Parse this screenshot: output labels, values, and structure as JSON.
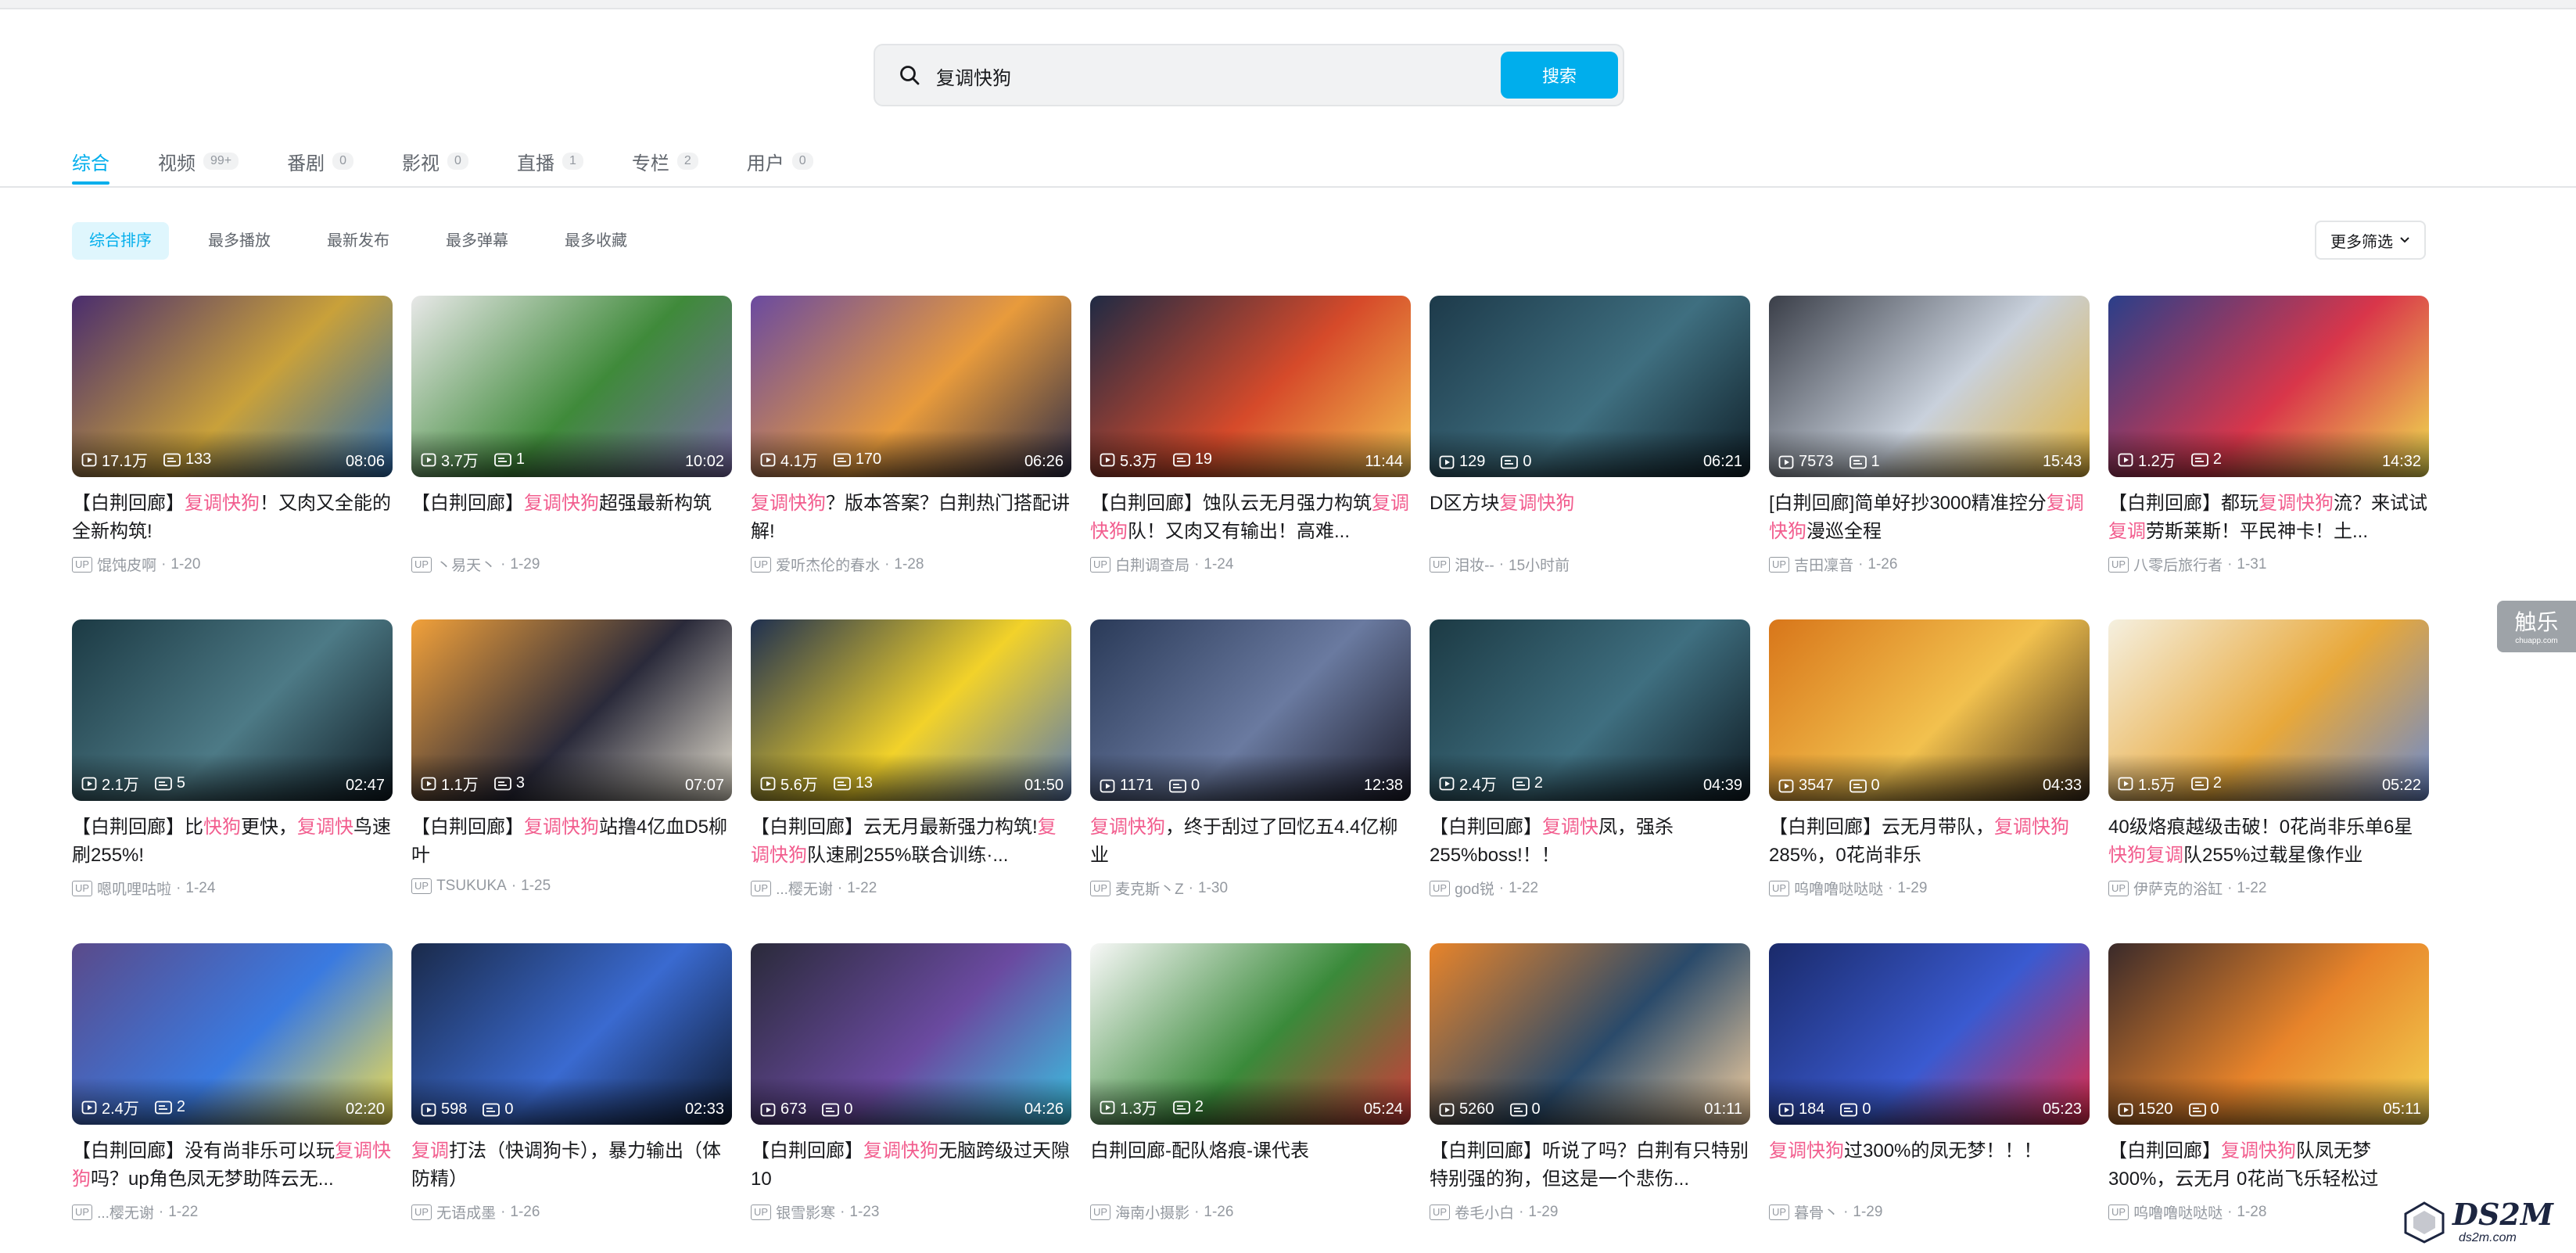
{
  "search": {
    "query": "复调快狗",
    "button_label": "搜索"
  },
  "tabs": [
    {
      "label": "综合",
      "count": ""
    },
    {
      "label": "视频",
      "count": "99+"
    },
    {
      "label": "番剧",
      "count": "0"
    },
    {
      "label": "影视",
      "count": "0"
    },
    {
      "label": "直播",
      "count": "1"
    },
    {
      "label": "专栏",
      "count": "2"
    },
    {
      "label": "用户",
      "count": "0"
    }
  ],
  "sort": [
    "综合排序",
    "最多播放",
    "最新发布",
    "最多弹幕",
    "最多收藏"
  ],
  "more_filter_label": "更多筛选",
  "up_badge": "UP",
  "side_widget": {
    "big": "触乐",
    "small": "chuapp.com"
  },
  "watermark": {
    "text": "DS2M",
    "sub": "ds2m.com"
  },
  "videos": [
    {
      "plays": "17.1万",
      "danmaku": "133",
      "duration": "08:06",
      "title": "【白荆回廊】<h>复调快狗</h>！又肉又全能的全新构筑!",
      "author": "馄饨皮啊",
      "date": "1-20",
      "colors": [
        "#4a2d6e",
        "#c9a13a",
        "#2b6cb0"
      ]
    },
    {
      "plays": "3.7万",
      "danmaku": "1",
      "duration": "10:02",
      "title": "【白荆回廊】<h>复调快狗</h>超强最新构筑",
      "author": "丶易天丶",
      "date": "1-29",
      "colors": [
        "#e8e8e8",
        "#3f8a3a",
        "#7b6aa8"
      ]
    },
    {
      "plays": "4.1万",
      "danmaku": "170",
      "duration": "06:26",
      "title": "<h>复调快狗</h>？版本答案？白荆热门搭配讲解!",
      "author": "爱听杰伦的春水",
      "date": "1-28",
      "colors": [
        "#6a4aa0",
        "#e89b3c",
        "#2c2c48"
      ]
    },
    {
      "plays": "5.3万",
      "danmaku": "19",
      "duration": "11:44",
      "title": "【白荆回廊】蚀队云无月强力构筑<h>复调快狗</h>队！又肉又有输出！高难...",
      "author": "白荆调查局",
      "date": "1-24",
      "colors": [
        "#1f2a44",
        "#d64a2a",
        "#f2c14e"
      ]
    },
    {
      "plays": "129",
      "danmaku": "0",
      "duration": "06:21",
      "title": "D区方块<h>复调快狗</h>",
      "author": "泪妆-- ",
      "date": "15小时前",
      "colors": [
        "#1d3a4a",
        "#3f6f80",
        "#0f1f28"
      ]
    },
    {
      "plays": "7573",
      "danmaku": "1",
      "duration": "15:43",
      "title": "[白荆回廊]简单好抄3000精准控分<h>复调快狗</h>漫巡全程",
      "author": "吉田凜音",
      "date": "1-26",
      "colors": [
        "#3a3e48",
        "#c9d1dc",
        "#e2b23a"
      ]
    },
    {
      "plays": "1.2万",
      "danmaku": "2",
      "duration": "14:32",
      "title": "【白荆回廊】都玩<h>复调快狗</h>流？来试试<h>复调</h>劳斯莱斯！平民神卡！土...",
      "author": "八零后旅行者",
      "date": "1-31",
      "colors": [
        "#2a3f8a",
        "#d9364a",
        "#f0e050"
      ]
    },
    {
      "plays": "2.1万",
      "danmaku": "5",
      "duration": "02:47",
      "title": "【白荆回廊】比<h>快狗</h>更快，<h>复调快</h>鸟速刷255%!",
      "author": "嗯叽哩咕啦",
      "date": "1-24",
      "colors": [
        "#1c3a44",
        "#4d7a86",
        "#0e1a22"
      ]
    },
    {
      "plays": "1.1万",
      "danmaku": "3",
      "duration": "07:07",
      "title": "【白荆回廊】<h>复调快狗</h>站撸4亿血D5柳叶",
      "author": "TSUKUKA",
      "date": "1-25",
      "colors": [
        "#f2a13a",
        "#2a2a3a",
        "#e6e0d0"
      ]
    },
    {
      "plays": "5.6万",
      "danmaku": "13",
      "duration": "01:50",
      "title": "【白荆回廊】云无月最新强力构筑!<h>复调快狗</h>队速刷255%联合训练·...",
      "author": "...樱无谢",
      "date": "1-22",
      "colors": [
        "#1f3050",
        "#f2d22a",
        "#5a7ab0"
      ]
    },
    {
      "plays": "1171",
      "danmaku": "0",
      "duration": "12:38",
      "title": "<h>复调快狗</h>，终于刮过了回忆五4.4亿柳业",
      "author": "麦克斯丶Z",
      "date": "1-30",
      "colors": [
        "#2a3a58",
        "#6a7aa0",
        "#1a1a28"
      ]
    },
    {
      "plays": "2.4万",
      "danmaku": "2",
      "duration": "04:39",
      "title": "【白荆回廊】<h>复调快</h>凤，强杀255%boss!！！",
      "author": "god锐",
      "date": "1-22",
      "colors": [
        "#1c3a44",
        "#3f6f80",
        "#0e1a22"
      ]
    },
    {
      "plays": "3547",
      "danmaku": "0",
      "duration": "04:33",
      "title": "【白荆回廊】云无月带队，<h>复调快狗</h>285%，0花尚非乐",
      "author": "呜噜噜哒哒哒",
      "date": "1-29",
      "colors": [
        "#d8761a",
        "#f2c14e",
        "#3a2a1a"
      ]
    },
    {
      "plays": "1.5万",
      "danmaku": "2",
      "duration": "05:22",
      "title": "40级烙痕越级击破！0花尚非乐单6星<h>快狗复调</h>队255%过载星像作业",
      "author": "伊萨克的浴缸",
      "date": "1-22",
      "colors": [
        "#f5f0e0",
        "#e8a83a",
        "#6a8ad0"
      ]
    },
    {
      "plays": "2.4万",
      "danmaku": "2",
      "duration": "02:20",
      "title": "【白荆回廊】没有尚非乐可以玩<h>复调快狗</h>吗？up角色凤无梦助阵云无...",
      "author": "...樱无谢",
      "date": "1-22",
      "colors": [
        "#5a4a8a",
        "#3a7ae0",
        "#f2e050"
      ]
    },
    {
      "plays": "598",
      "danmaku": "0",
      "duration": "02:33",
      "title": "<h>复调</h>打法（快调狗卡），暴力输出（体防精）",
      "author": "无语成墨",
      "date": "1-26",
      "colors": [
        "#1a2a4a",
        "#3a6ad0",
        "#0e1a30"
      ]
    },
    {
      "plays": "673",
      "danmaku": "0",
      "duration": "04:26",
      "title": "【白荆回廊】<h>复调快狗</h>无脑跨级过天隙10",
      "author": "银雪影寒",
      "date": "1-23",
      "colors": [
        "#2a2a3a",
        "#6a4aa0",
        "#3ac0e0"
      ]
    },
    {
      "plays": "1.3万",
      "danmaku": "2",
      "duration": "05:24",
      "title": "白荆回廊-配队烙痕-课代表",
      "author": "海南小摄影",
      "date": "1-26",
      "colors": [
        "#f8f8f8",
        "#3a8a3a",
        "#d03a3a"
      ]
    },
    {
      "plays": "5260",
      "danmaku": "0",
      "duration": "01:11",
      "title": "【白荆回廊】听说了吗？白荆有只特别特别强的狗，但这是一个悲伤...",
      "author": "卷毛小白",
      "date": "1-29",
      "colors": [
        "#e8842a",
        "#2a4a6a",
        "#f5d0a0"
      ]
    },
    {
      "plays": "184",
      "danmaku": "0",
      "duration": "05:23",
      "title": "<h>复调快狗</h>过300%的凤无梦！！！",
      "author": "暮骨丶",
      "date": "1-29",
      "colors": [
        "#1a2a6a",
        "#3a5ad0",
        "#e02a4a"
      ]
    },
    {
      "plays": "1520",
      "danmaku": "0",
      "duration": "05:11",
      "title": "【白荆回廊】<h>复调快狗</h>队凤无梦300%，云无月 0花尚飞乐轻松过",
      "author": "呜噜噜哒哒哒",
      "date": "1-28",
      "colors": [
        "#3a2a2a",
        "#e8842a",
        "#f2d050"
      ]
    }
  ]
}
